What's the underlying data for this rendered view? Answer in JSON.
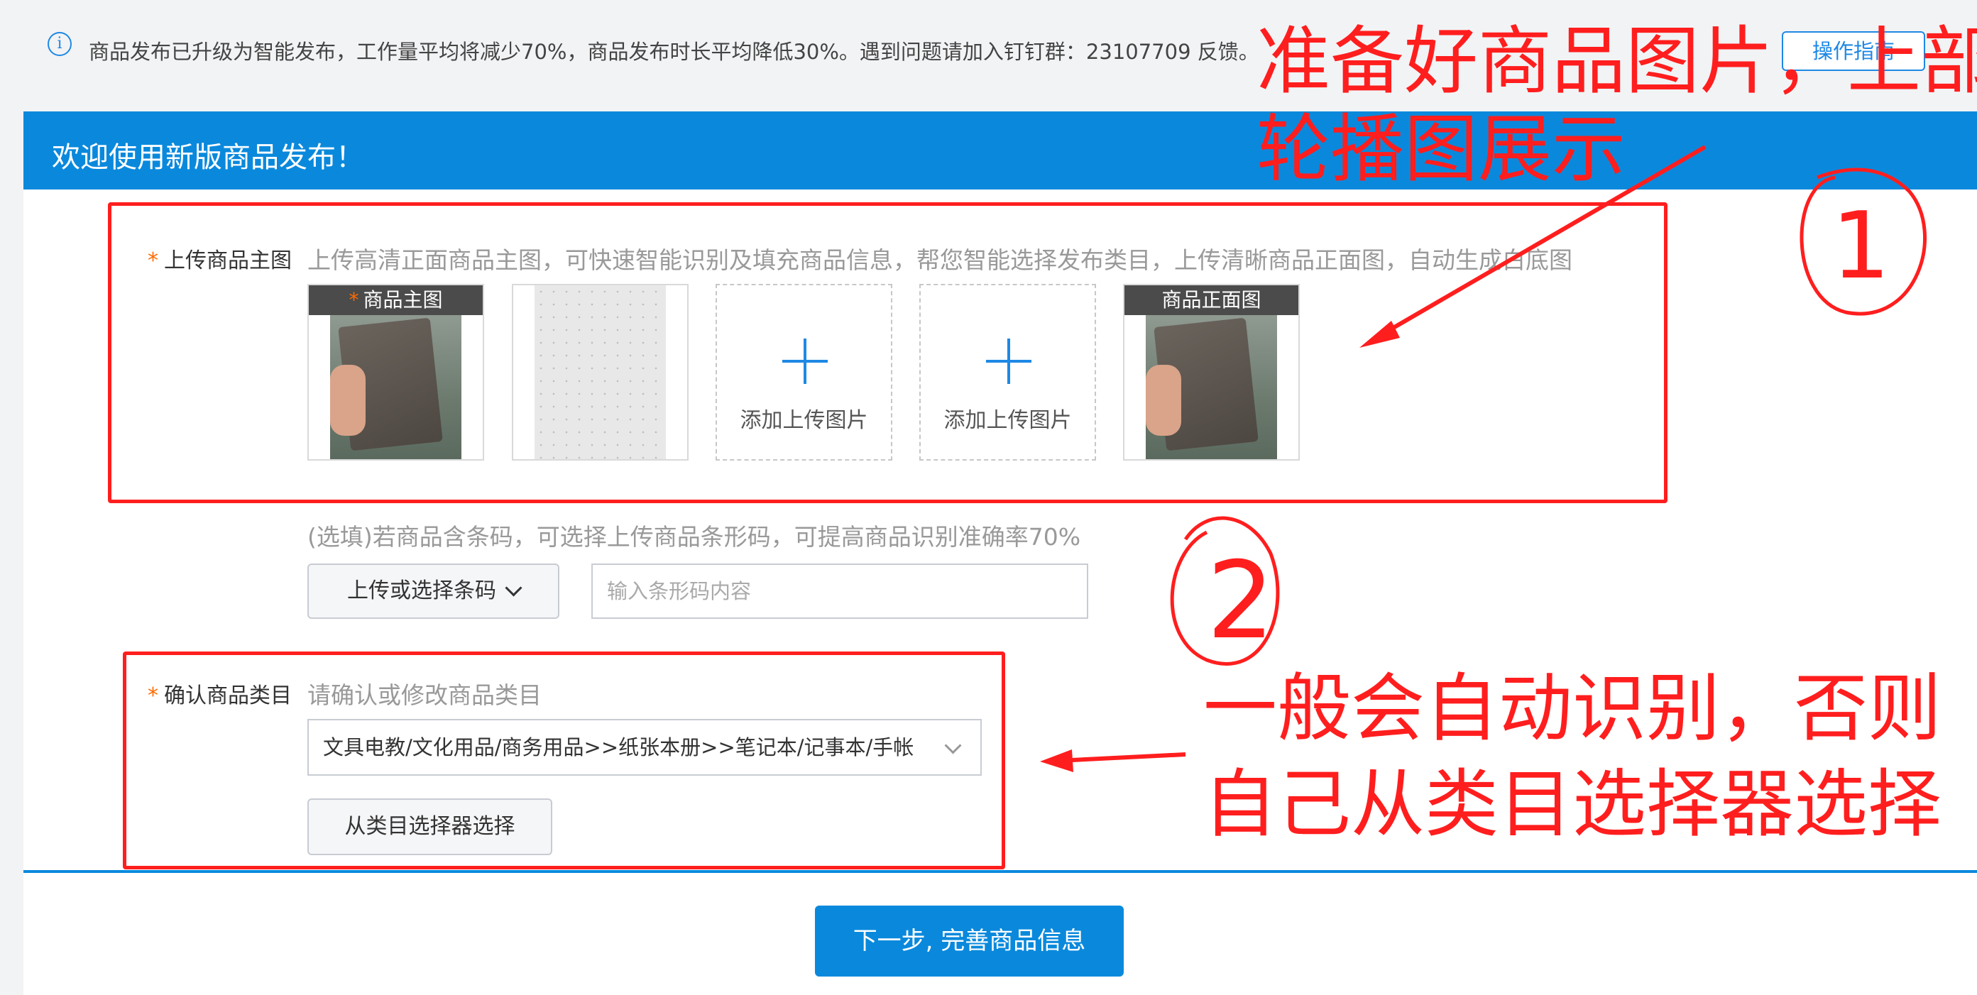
{
  "notice": {
    "text": "商品发布已升级为智能发布，工作量平均将减少70%，商品发布时长平均降低30%。遇到问题请加入钉钉群：23107709 反馈。",
    "guide_button": "操作指南"
  },
  "welcome": {
    "title": "欢迎使用新版商品发布！"
  },
  "main_image": {
    "label": "上传商品主图",
    "required_star": "*",
    "hint": "上传高清正面商品主图，可快速智能识别及填充商品信息，帮您智能选择发布类目，上传清晰商品正面图，自动生成白底图",
    "cards": [
      {
        "tag": "商品主图",
        "starred": true
      },
      {
        "tag": ""
      },
      {
        "add_label": "添加上传图片"
      },
      {
        "add_label": "添加上传图片"
      },
      {
        "tag": "商品正面图"
      }
    ]
  },
  "barcode": {
    "hint": "(选填)若商品含条码，可选择上传商品条形码，可提高商品识别准确率70%",
    "select_button": "上传或选择条码",
    "input_placeholder": "输入条形码内容"
  },
  "category": {
    "label": "确认商品类目",
    "required_star": "*",
    "hint": "请确认或修改商品类目",
    "selected": "文具电教/文化用品/商务用品>>纸张本册>>笔记本/记事本/手帐",
    "picker_button": "从类目选择器选择"
  },
  "footer": {
    "next_button": "下一步, 完善商品信息"
  },
  "annotations": {
    "top_note_line1": "准备好商品图片，上部",
    "top_note_line2": "轮播图展示",
    "circle_1": "1",
    "circle_2": "2",
    "bottom_note_line1": "一般会自动识别，否则",
    "bottom_note_line2": "自己从类目选择器选择",
    "color": "#ff1e1e"
  },
  "colors": {
    "brand_blue": "#0a89dc",
    "accent_blue": "#1e88e5",
    "required_orange": "#ff6a00"
  }
}
